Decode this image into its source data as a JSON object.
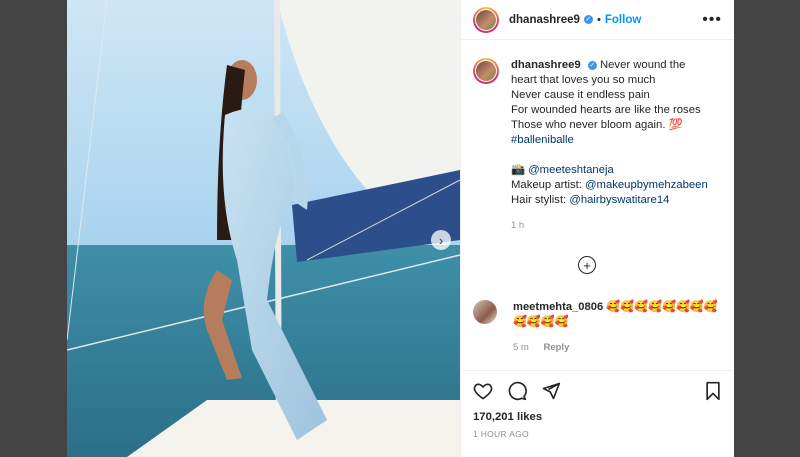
{
  "post": {
    "username": "dhanashree9",
    "follow_label": "Follow",
    "more_label": "•••",
    "caption_lines": [
      "Never wound the",
      "heart that loves you so much",
      "Never cause it endless pain",
      "For wounded hearts are like the roses",
      "Those who never bloom again. 💯"
    ],
    "hashtag": "#balleniballe",
    "credits": {
      "photo_emoji": "📸",
      "photo_handle": "@meeteshtaneja",
      "makeup_label": "Makeup artist: ",
      "makeup_handle": "@makeupbymehzabeen",
      "hair_label": "Hair stylist: ",
      "hair_handle": "@hairbyswatitare14"
    },
    "caption_time": "1 h",
    "load_more_label": "+",
    "comment": {
      "username": "meetmehta_0806",
      "text": "🥰🥰🥰🥰🥰🥰🥰🥰🥰🥰🥰🥰",
      "time": "5 m",
      "reply_label": "Reply"
    },
    "likes": "170,201 likes",
    "posted_ago": "1 HOUR AGO",
    "next_arrow": "›"
  },
  "icons": [
    "verified-badge",
    "heart-icon",
    "comment-icon",
    "share-icon",
    "save-icon"
  ]
}
